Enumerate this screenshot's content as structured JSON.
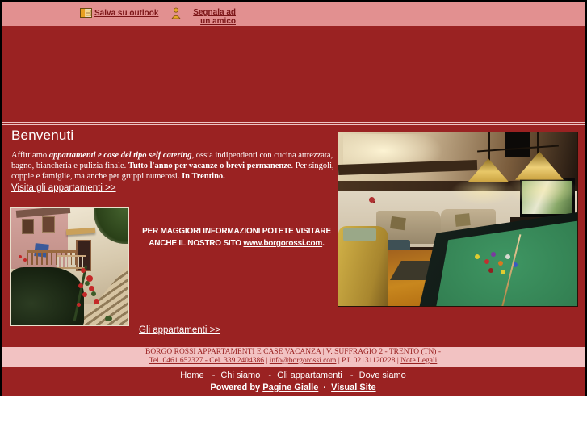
{
  "colors": {
    "page_red": "#9a2222",
    "topbar_pink": "#e29090",
    "band_pink": "#f2c2c2",
    "link_dark": "#7b1517",
    "text_white": "#ffffff"
  },
  "topbar": {
    "save_outlook_label": "Salva su outlook",
    "tell_friend_label": "Segnala ad un amico"
  },
  "main": {
    "title": "Benvenuti",
    "intro": {
      "seg1": "Affittiamo ",
      "seg2": "appartamenti e case del tipo self catering",
      "seg3": ", ossia indipendenti con cucina attrezzata, bagno, biancheria e pulizia finale. ",
      "seg4": "Tutto l'anno per vacanze o brevi permanenze",
      "seg5": ". Per singoli, coppie e famiglie, ma anche per gruppi numerosi. ",
      "seg6": "In Trentino."
    },
    "visit_apartments_link": "Visita gli appartamenti >>",
    "promo": {
      "line1": "PER MAGGIORI INFORMAZIONI POTETE VISITARE",
      "line2_prefix": "ANCHE IL NOSTRO SITO ",
      "line2_link": "www.borgorossi.com",
      "line2_suffix": "."
    },
    "apartments_link": "Gli appartamenti >>"
  },
  "footer": {
    "address_line": "BORGO ROSSI APPARTAMENTI E CASE VACANZA | V. SUFFRAGIO 2 - TRENTO (TN) -",
    "contacts": {
      "phone": "Tel. 0461 652327 - Cel. 339 2404386",
      "separator": "|",
      "email": "info@borgorossi.com",
      "vat": "P.I. 02131120228",
      "legal": "Note Legali"
    }
  },
  "nav": {
    "separator": "-",
    "items": [
      {
        "label": "Home"
      },
      {
        "label": "Chi siamo"
      },
      {
        "label": "Gli appartamenti"
      },
      {
        "label": "Dove siamo"
      }
    ]
  },
  "powered": {
    "prefix": "Powered by",
    "link1": "Pagine Gialle",
    "separator": "·",
    "link2": "Visual Site"
  }
}
